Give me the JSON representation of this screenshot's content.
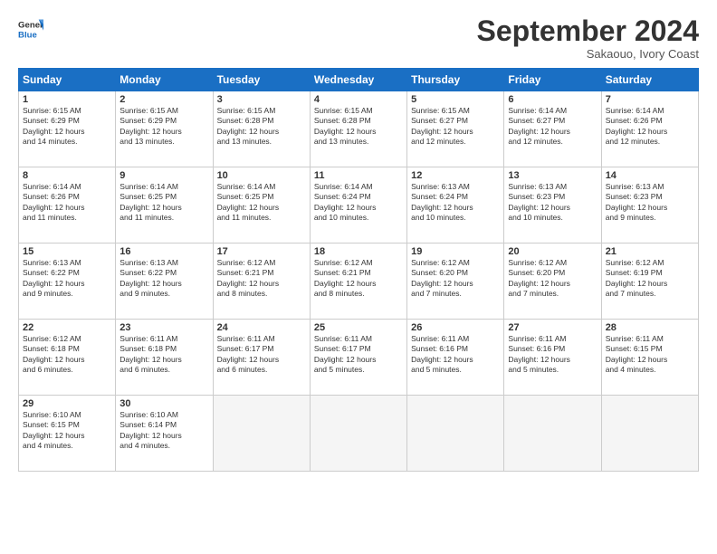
{
  "header": {
    "logo_general": "General",
    "logo_blue": "Blue",
    "month": "September 2024",
    "location": "Sakaouo, Ivory Coast"
  },
  "days_of_week": [
    "Sunday",
    "Monday",
    "Tuesday",
    "Wednesday",
    "Thursday",
    "Friday",
    "Saturday"
  ],
  "weeks": [
    [
      {
        "day": "1",
        "lines": [
          "Sunrise: 6:15 AM",
          "Sunset: 6:29 PM",
          "Daylight: 12 hours",
          "and 14 minutes."
        ]
      },
      {
        "day": "2",
        "lines": [
          "Sunrise: 6:15 AM",
          "Sunset: 6:29 PM",
          "Daylight: 12 hours",
          "and 13 minutes."
        ]
      },
      {
        "day": "3",
        "lines": [
          "Sunrise: 6:15 AM",
          "Sunset: 6:28 PM",
          "Daylight: 12 hours",
          "and 13 minutes."
        ]
      },
      {
        "day": "4",
        "lines": [
          "Sunrise: 6:15 AM",
          "Sunset: 6:28 PM",
          "Daylight: 12 hours",
          "and 13 minutes."
        ]
      },
      {
        "day": "5",
        "lines": [
          "Sunrise: 6:15 AM",
          "Sunset: 6:27 PM",
          "Daylight: 12 hours",
          "and 12 minutes."
        ]
      },
      {
        "day": "6",
        "lines": [
          "Sunrise: 6:14 AM",
          "Sunset: 6:27 PM",
          "Daylight: 12 hours",
          "and 12 minutes."
        ]
      },
      {
        "day": "7",
        "lines": [
          "Sunrise: 6:14 AM",
          "Sunset: 6:26 PM",
          "Daylight: 12 hours",
          "and 12 minutes."
        ]
      }
    ],
    [
      {
        "day": "8",
        "lines": [
          "Sunrise: 6:14 AM",
          "Sunset: 6:26 PM",
          "Daylight: 12 hours",
          "and 11 minutes."
        ]
      },
      {
        "day": "9",
        "lines": [
          "Sunrise: 6:14 AM",
          "Sunset: 6:25 PM",
          "Daylight: 12 hours",
          "and 11 minutes."
        ]
      },
      {
        "day": "10",
        "lines": [
          "Sunrise: 6:14 AM",
          "Sunset: 6:25 PM",
          "Daylight: 12 hours",
          "and 11 minutes."
        ]
      },
      {
        "day": "11",
        "lines": [
          "Sunrise: 6:14 AM",
          "Sunset: 6:24 PM",
          "Daylight: 12 hours",
          "and 10 minutes."
        ]
      },
      {
        "day": "12",
        "lines": [
          "Sunrise: 6:13 AM",
          "Sunset: 6:24 PM",
          "Daylight: 12 hours",
          "and 10 minutes."
        ]
      },
      {
        "day": "13",
        "lines": [
          "Sunrise: 6:13 AM",
          "Sunset: 6:23 PM",
          "Daylight: 12 hours",
          "and 10 minutes."
        ]
      },
      {
        "day": "14",
        "lines": [
          "Sunrise: 6:13 AM",
          "Sunset: 6:23 PM",
          "Daylight: 12 hours",
          "and 9 minutes."
        ]
      }
    ],
    [
      {
        "day": "15",
        "lines": [
          "Sunrise: 6:13 AM",
          "Sunset: 6:22 PM",
          "Daylight: 12 hours",
          "and 9 minutes."
        ]
      },
      {
        "day": "16",
        "lines": [
          "Sunrise: 6:13 AM",
          "Sunset: 6:22 PM",
          "Daylight: 12 hours",
          "and 9 minutes."
        ]
      },
      {
        "day": "17",
        "lines": [
          "Sunrise: 6:12 AM",
          "Sunset: 6:21 PM",
          "Daylight: 12 hours",
          "and 8 minutes."
        ]
      },
      {
        "day": "18",
        "lines": [
          "Sunrise: 6:12 AM",
          "Sunset: 6:21 PM",
          "Daylight: 12 hours",
          "and 8 minutes."
        ]
      },
      {
        "day": "19",
        "lines": [
          "Sunrise: 6:12 AM",
          "Sunset: 6:20 PM",
          "Daylight: 12 hours",
          "and 7 minutes."
        ]
      },
      {
        "day": "20",
        "lines": [
          "Sunrise: 6:12 AM",
          "Sunset: 6:20 PM",
          "Daylight: 12 hours",
          "and 7 minutes."
        ]
      },
      {
        "day": "21",
        "lines": [
          "Sunrise: 6:12 AM",
          "Sunset: 6:19 PM",
          "Daylight: 12 hours",
          "and 7 minutes."
        ]
      }
    ],
    [
      {
        "day": "22",
        "lines": [
          "Sunrise: 6:12 AM",
          "Sunset: 6:18 PM",
          "Daylight: 12 hours",
          "and 6 minutes."
        ]
      },
      {
        "day": "23",
        "lines": [
          "Sunrise: 6:11 AM",
          "Sunset: 6:18 PM",
          "Daylight: 12 hours",
          "and 6 minutes."
        ]
      },
      {
        "day": "24",
        "lines": [
          "Sunrise: 6:11 AM",
          "Sunset: 6:17 PM",
          "Daylight: 12 hours",
          "and 6 minutes."
        ]
      },
      {
        "day": "25",
        "lines": [
          "Sunrise: 6:11 AM",
          "Sunset: 6:17 PM",
          "Daylight: 12 hours",
          "and 5 minutes."
        ]
      },
      {
        "day": "26",
        "lines": [
          "Sunrise: 6:11 AM",
          "Sunset: 6:16 PM",
          "Daylight: 12 hours",
          "and 5 minutes."
        ]
      },
      {
        "day": "27",
        "lines": [
          "Sunrise: 6:11 AM",
          "Sunset: 6:16 PM",
          "Daylight: 12 hours",
          "and 5 minutes."
        ]
      },
      {
        "day": "28",
        "lines": [
          "Sunrise: 6:11 AM",
          "Sunset: 6:15 PM",
          "Daylight: 12 hours",
          "and 4 minutes."
        ]
      }
    ],
    [
      {
        "day": "29",
        "lines": [
          "Sunrise: 6:10 AM",
          "Sunset: 6:15 PM",
          "Daylight: 12 hours",
          "and 4 minutes."
        ]
      },
      {
        "day": "30",
        "lines": [
          "Sunrise: 6:10 AM",
          "Sunset: 6:14 PM",
          "Daylight: 12 hours",
          "and 4 minutes."
        ]
      },
      {
        "day": "",
        "lines": []
      },
      {
        "day": "",
        "lines": []
      },
      {
        "day": "",
        "lines": []
      },
      {
        "day": "",
        "lines": []
      },
      {
        "day": "",
        "lines": []
      }
    ]
  ]
}
